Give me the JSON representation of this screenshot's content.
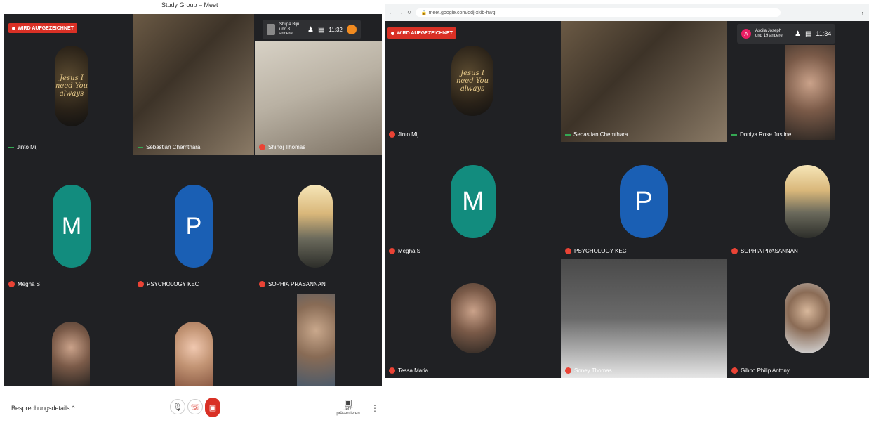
{
  "top_caption": "Study Group – Meet",
  "left": {
    "recording_label": "WIRD AUFGEZEICHNET",
    "participants_info": "Shilpa Biju und 8 andere",
    "time": "11:32",
    "tiles": [
      {
        "name": "Jinto Mij"
      },
      {
        "name": "Sebastian Chemthara"
      },
      {
        "name": "Shinoj Thomas"
      },
      {
        "name": "Megha S",
        "letter": "M"
      },
      {
        "name": "PSYCHOLOGY KEC",
        "letter": "P"
      },
      {
        "name": "SOPHIA PRASANNAN"
      }
    ],
    "meeting_details": "Besprechungsdetails",
    "present_label": "Jetzt präsentieren",
    "mic_icon": "mic-icon",
    "colors": {
      "bg": "#202124",
      "megha": "#128c7e",
      "psych": "#1a5fb4",
      "record": "#d93025"
    }
  },
  "right": {
    "url": "meet.google.com/ddj-xkib-hwg",
    "recording_label": "WIRD AUFGEZEICHNET",
    "participants_info_line1": "Ascila Joseph",
    "participants_info_line2": "und 19 andere",
    "time": "11:34",
    "tiles": [
      {
        "name": "Jinto Mij"
      },
      {
        "name": "Sebastian Chemthara"
      },
      {
        "name": "Doniya Rose Justine"
      },
      {
        "name": "Megha S",
        "letter": "M"
      },
      {
        "name": "PSYCHOLOGY KEC",
        "letter": "P"
      },
      {
        "name": "SOPHIA PRASANNAN"
      },
      {
        "name": "Tessa Maria"
      },
      {
        "name": "Soney Thomas"
      },
      {
        "name": "Gibbo Philip Antony"
      }
    ],
    "avatar_letter": "A"
  },
  "jesus_text": "Jesus I need You always"
}
